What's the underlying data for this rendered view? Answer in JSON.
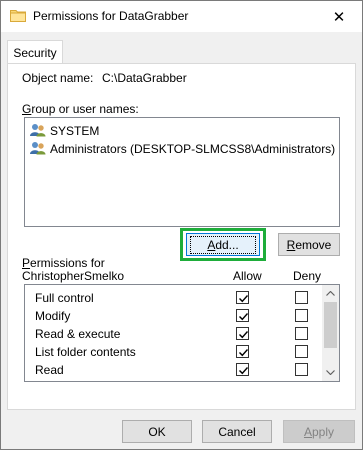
{
  "window": {
    "title": "Permissions for DataGrabber",
    "close_glyph": "✕"
  },
  "tabs": [
    {
      "label": "Security"
    }
  ],
  "security": {
    "object_name_label": "Object name:",
    "object_name_value": "C:\\DataGrabber",
    "group_label": "Group or user names:",
    "groups": [
      {
        "name": "SYSTEM",
        "icon": "users-icon"
      },
      {
        "name": "Administrators (DESKTOP-SLMCSS8\\Administrators)",
        "icon": "users-icon"
      }
    ],
    "add_button": "Add...",
    "remove_button": "Remove",
    "permissions_label_line1": "Permissions for",
    "permissions_label_line2": "ChristopherSmelko",
    "allow_header": "Allow",
    "deny_header": "Deny",
    "permissions": [
      {
        "name": "Full control",
        "allow": true,
        "deny": false
      },
      {
        "name": "Modify",
        "allow": true,
        "deny": false
      },
      {
        "name": "Read & execute",
        "allow": true,
        "deny": false
      },
      {
        "name": "List folder contents",
        "allow": true,
        "deny": false
      },
      {
        "name": "Read",
        "allow": true,
        "deny": false
      },
      {
        "name": "",
        "allow": true,
        "deny": false
      }
    ]
  },
  "footer": {
    "ok": "OK",
    "cancel": "Cancel",
    "apply": "Apply"
  },
  "colors": {
    "highlight": "#1ead3a",
    "focus_border": "#0078d7"
  }
}
